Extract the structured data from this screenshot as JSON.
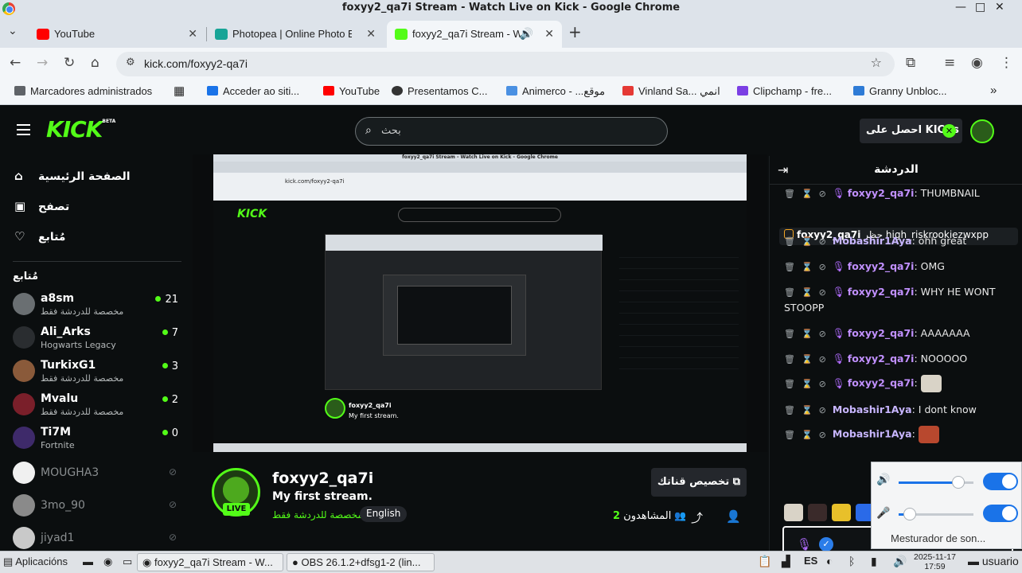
{
  "window": {
    "title": "foxyy2_qa7i Stream - Watch Live on Kick - Google Chrome"
  },
  "tabs": [
    {
      "label": "YouTube",
      "color": "#ff0000"
    },
    {
      "label": "Photopea | Online Photo E",
      "color": "#18a497"
    },
    {
      "label": "foxyy2_qa7i Stream - W",
      "color": "#53fc18"
    }
  ],
  "address": {
    "url": "kick.com/foxyy2-qa7i"
  },
  "bookmarks": [
    {
      "label": "Marcadores administrados",
      "color": "#5f6368"
    },
    {
      "label": "Acceder ao siti...",
      "color": "#1a73e8"
    },
    {
      "label": "YouTube",
      "color": "#ff0000"
    },
    {
      "label": "Presentamos C...",
      "color": "#333333"
    },
    {
      "label": "Animerco - ...موقع",
      "color": "#4a90e2"
    },
    {
      "label": "Vinland Sa... انمي",
      "color": "#e53935"
    },
    {
      "label": "Clipchamp - fre...",
      "color": "#7b3fe4"
    },
    {
      "label": "Granny Unbloc...",
      "color": "#2e7bd6"
    }
  ],
  "kick": {
    "logo": "KICK",
    "logo_sup": "BETA",
    "search_placeholder": "بحث",
    "get_kicks": "احصل على KICKs"
  },
  "sidebar": {
    "nav": [
      {
        "label": "الصفحة الرئيسية",
        "icon": "home-icon",
        "glyph": "⌂"
      },
      {
        "label": "تصفح",
        "icon": "browse-icon",
        "glyph": "▣"
      },
      {
        "label": "مُتابع",
        "icon": "heart-icon",
        "glyph": "♡"
      }
    ],
    "following_title": "مُتابع",
    "channels": [
      {
        "name": "a8sm",
        "sub": "مخصصة للدردشة فقط",
        "count": "21",
        "color": "#6a6f72"
      },
      {
        "name": "Ali_Arks",
        "sub": "Hogwarts Legacy",
        "count": "7",
        "color": "#2a2d30"
      },
      {
        "name": "TurkixG1",
        "sub": "مخصصة للدردشة فقط",
        "count": "3",
        "color": "#8a5a3a"
      },
      {
        "name": "Mvalu",
        "sub": "مخصصة للدردشة فقط",
        "count": "2",
        "color": "#7a1f2a"
      },
      {
        "name": "Ti7M",
        "sub": "Fortnite",
        "count": "0",
        "color": "#3e2a6a"
      }
    ],
    "offline": [
      {
        "name": "MOUGHA3",
        "color": "#f0f0f0"
      },
      {
        "name": "3mo_90",
        "color": "#8a8a8a"
      },
      {
        "name": "jiyad1",
        "color": "#c9c9c9"
      }
    ]
  },
  "stream": {
    "channel": "foxyy2_qa7i",
    "title": "My first stream.",
    "category": "مخصصة للدردشة فقط",
    "language": "English",
    "live": "LIVE",
    "customize": "تخصيص قناتك",
    "viewers_label": "المشاهدون",
    "viewers_count": "2"
  },
  "chat": {
    "title": "الدردشة",
    "pinned_user": "foxyy2_qa7i",
    "pinned_text": "حظر high_riskrookiezwxpp",
    "messages": [
      {
        "user": "foxyy2_qa7i",
        "text": ": THUMBNAIL",
        "mic": true
      },
      {
        "user": "Mobashir1Aya",
        "text": ": ohh great",
        "mic": false
      },
      {
        "user": "foxyy2_qa7i",
        "text": ": OMG",
        "mic": true
      },
      {
        "user": "foxyy2_qa7i",
        "text": ": WHY HE WONT STOOPP",
        "mic": true
      },
      {
        "user": "foxyy2_qa7i",
        "text": ": AAAAAAA",
        "mic": true
      },
      {
        "user": "foxyy2_qa7i",
        "text": ": NOOOOO",
        "mic": true
      },
      {
        "user": "foxyy2_qa7i",
        "text": ":",
        "mic": true
      },
      {
        "user": "Mobashir1Aya",
        "text": ": I dont know",
        "mic": false
      },
      {
        "user": "Mobashir1Aya",
        "text": ":",
        "mic": false
      }
    ]
  },
  "volume_popup": {
    "mixer": "Mesturador de son...",
    "output_level": 0.8,
    "input_level": 0.15
  },
  "taskbar": {
    "apps_label": "Aplicacións",
    "windows": [
      "foxyy2_qa7i Stream - W...",
      "OBS 26.1.2+dfsg1-2 (lin..."
    ],
    "lang": "ES",
    "date": "2025-11-17",
    "time": "17:59",
    "user": "usuario"
  },
  "mini_screen": {
    "title": "foxyy2_qa7i Stream - Watch Live on Kick - Google Chrome",
    "url": "kick.com/foxyy2-qa7i",
    "logo": "KICK",
    "channel": "foxyy2_qa7i",
    "title2": "My first stream."
  }
}
